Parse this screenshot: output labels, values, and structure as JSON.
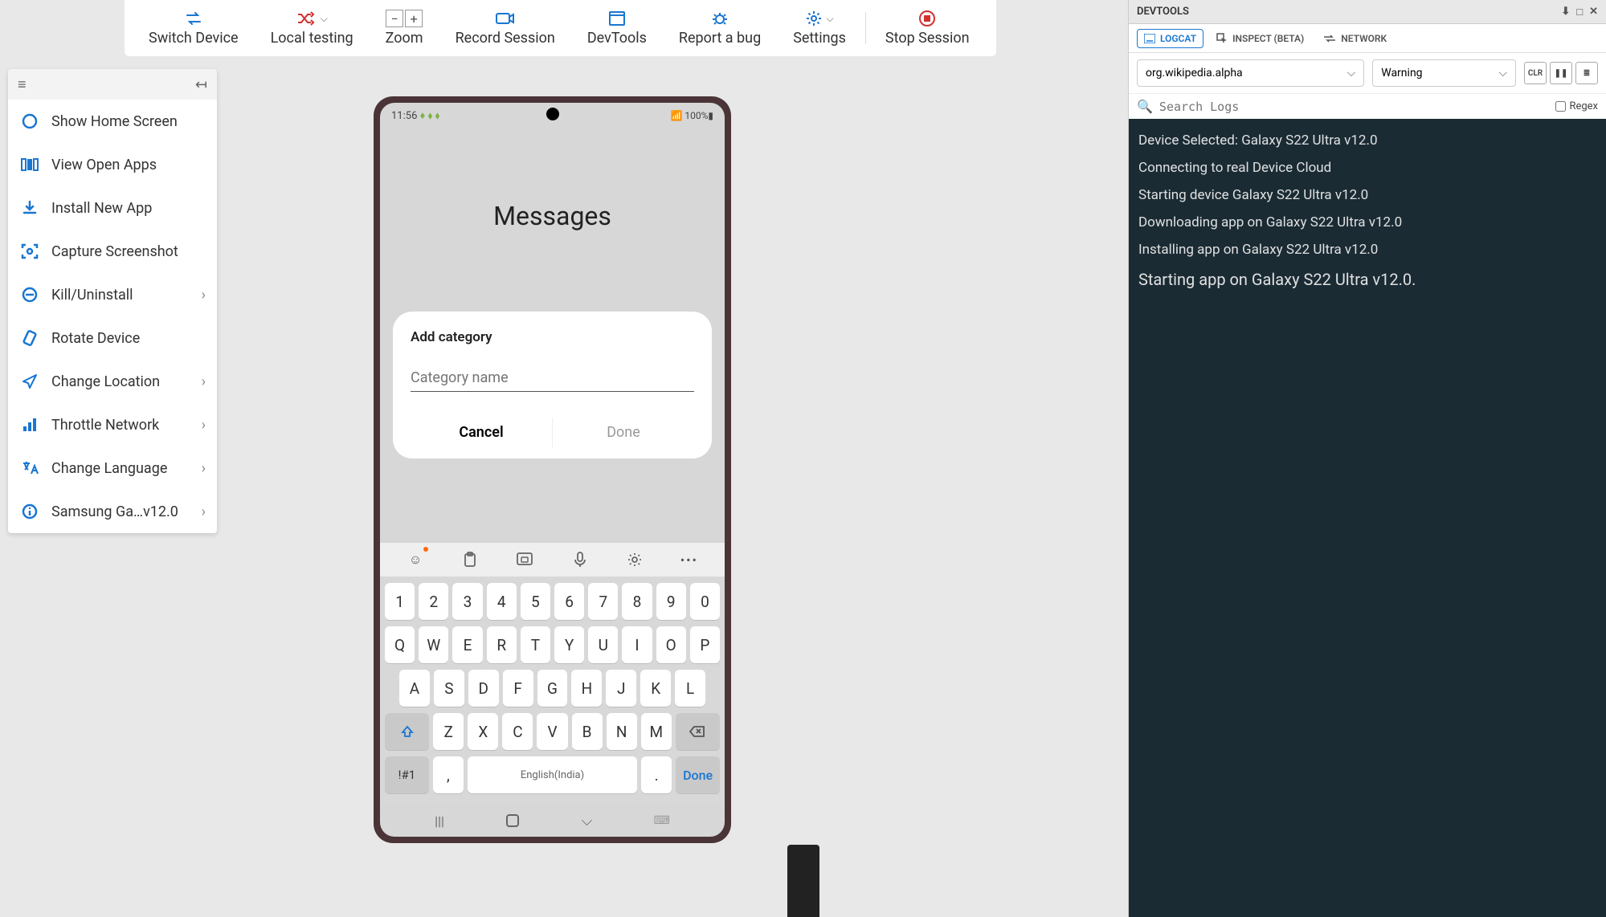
{
  "toolbar": {
    "switch_device": "Switch Device",
    "local_testing": "Local testing",
    "zoom": "Zoom",
    "record_session": "Record Session",
    "devtools": "DevTools",
    "report_bug": "Report a bug",
    "settings": "Settings",
    "stop_session": "Stop Session"
  },
  "sidebar": {
    "items": [
      {
        "label": "Show Home Screen",
        "has_sub": false
      },
      {
        "label": "View Open Apps",
        "has_sub": false
      },
      {
        "label": "Install New App",
        "has_sub": false
      },
      {
        "label": "Capture Screenshot",
        "has_sub": false
      },
      {
        "label": "Kill/Uninstall",
        "has_sub": true
      },
      {
        "label": "Rotate Device",
        "has_sub": false
      },
      {
        "label": "Change Location",
        "has_sub": true
      },
      {
        "label": "Throttle Network",
        "has_sub": true
      },
      {
        "label": "Change Language",
        "has_sub": true
      },
      {
        "label": "Samsung Ga…v12.0",
        "has_sub": true
      }
    ]
  },
  "phone": {
    "status_time": "11:56",
    "status_right": "100%",
    "app_title": "Messages",
    "dialog": {
      "title": "Add category",
      "placeholder": "Category name",
      "cancel": "Cancel",
      "done": "Done"
    },
    "keyboard": {
      "row_num": [
        "1",
        "2",
        "3",
        "4",
        "5",
        "6",
        "7",
        "8",
        "9",
        "0"
      ],
      "row1": [
        "Q",
        "W",
        "E",
        "R",
        "T",
        "Y",
        "U",
        "I",
        "O",
        "P"
      ],
      "row2": [
        "A",
        "S",
        "D",
        "F",
        "G",
        "H",
        "J",
        "K",
        "L"
      ],
      "row3": [
        "Z",
        "X",
        "C",
        "V",
        "B",
        "N",
        "M"
      ],
      "sym": "!#1",
      "comma": ",",
      "space": "English(India)",
      "period": ".",
      "done": "Done"
    }
  },
  "devtools": {
    "title": "DEVTOOLS",
    "tabs": {
      "logcat": "LOGCAT",
      "inspect": "INSPECT (BETA)",
      "network": "NETWORK"
    },
    "package_select": "org.wikipedia.alpha",
    "level_select": "Warning",
    "clr_btn": "CLR",
    "search_placeholder": "Search Logs",
    "regex_label": "Regex",
    "log_lines": [
      "Device Selected: Galaxy S22 Ultra v12.0",
      "Connecting to real Device Cloud",
      "Starting device Galaxy S22 Ultra v12.0",
      "Downloading app on Galaxy S22 Ultra v12.0",
      "Installing app on Galaxy S22 Ultra v12.0",
      "Starting app on Galaxy S22 Ultra v12.0."
    ]
  }
}
